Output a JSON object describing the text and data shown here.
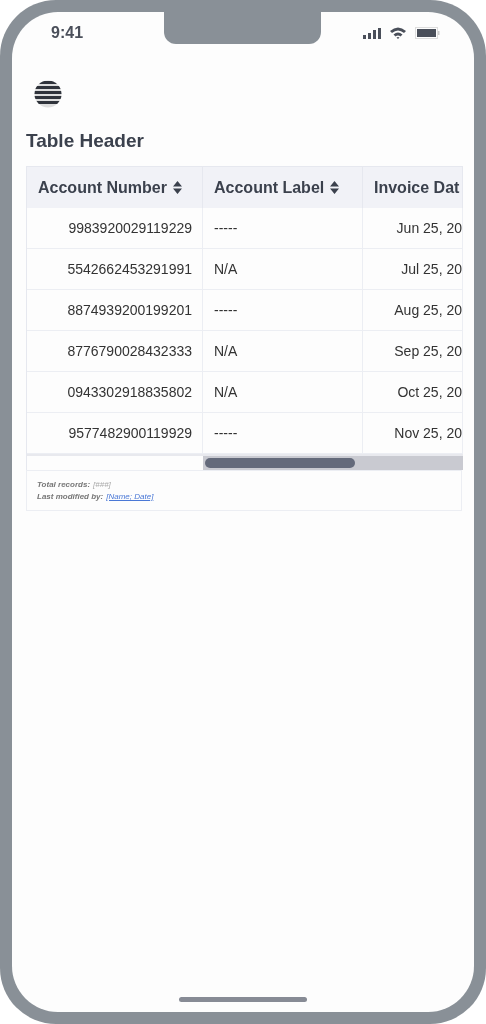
{
  "status_bar": {
    "time": "9:41"
  },
  "title": "Table Header",
  "table": {
    "columns": [
      {
        "label": "Account Number",
        "sortable": true
      },
      {
        "label": "Account Label",
        "sortable": true
      },
      {
        "label": "Invoice Dat"
      }
    ],
    "rows": [
      [
        "9983920029119229",
        "-----",
        "Jun 25, 20"
      ],
      [
        "5542662453291991",
        "N/A",
        "Jul 25, 20"
      ],
      [
        "8874939200199201",
        "-----",
        "Aug 25, 20"
      ],
      [
        "8776790028432333",
        "N/A",
        "Sep 25, 20"
      ],
      [
        "0943302918835802",
        "N/A",
        "Oct 25, 20"
      ],
      [
        "9577482900119929",
        "-----",
        "Nov 25, 20"
      ]
    ]
  },
  "footer": {
    "total_label": "Total records:",
    "total_value": "[###]",
    "modified_label": "Last modified by:",
    "modified_link": "[Name; Date]"
  }
}
